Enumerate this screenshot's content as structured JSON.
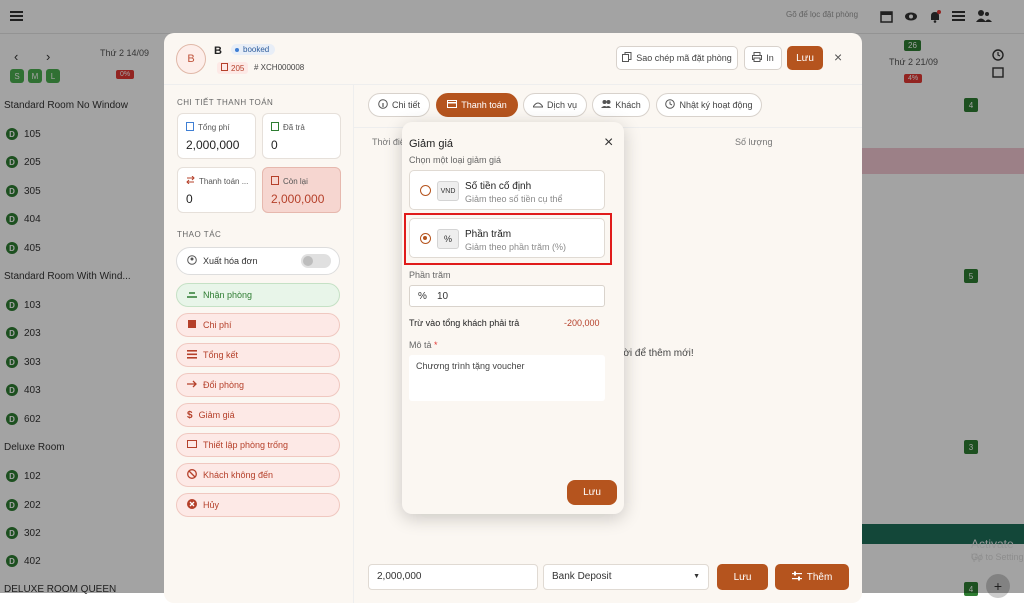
{
  "background": {
    "search_placeholder": "Gõ để lọc đặt phòng",
    "date_left": "Thứ 2 14/09",
    "date_right": "Thứ 2 21/09",
    "size_chips": [
      "S",
      "M",
      "L"
    ],
    "pct_left": "0%",
    "pct_right": "4%",
    "count_right": "26",
    "groups": [
      {
        "label": "Standard Room No Window",
        "rooms": [
          "105",
          "205",
          "305",
          "404",
          "405"
        ]
      },
      {
        "label": "Standard Room With Wind...",
        "rooms": [
          "103",
          "203",
          "303",
          "403",
          "602"
        ]
      },
      {
        "label": "Deluxe Room",
        "rooms": [
          "102",
          "202",
          "302",
          "402"
        ]
      },
      {
        "label": "DELUXE ROOM QUEEN",
        "rooms": []
      }
    ],
    "room_badge": "D",
    "right_counts": [
      "4",
      "5",
      "3",
      "4"
    ],
    "activate_title": "Activate W",
    "activate_sub": "Go to Setting"
  },
  "booking": {
    "avatar_letter": "B",
    "guest": "B",
    "status": "booked",
    "room": "205",
    "code": "# XCH000008",
    "copy_btn": "Sao chép mã đặt phòng",
    "print_btn": "In",
    "save_btn": "Lưu",
    "payment_title": "CHI TIẾT THANH TOÁN",
    "cards": {
      "total_label": "Tổng phí",
      "total_value": "2,000,000",
      "paid_label": "Đã trả",
      "paid_value": "0",
      "payment_label": "Thanh toán ...",
      "payment_value": "0",
      "remaining_label": "Còn lại",
      "remaining_value": "2,000,000"
    },
    "actions_title": "THAO TÁC",
    "actions": {
      "invoice": "Xuất hóa đơn",
      "checkin": "Nhận phòng",
      "cost": "Chi phí",
      "summary": "Tổng kết",
      "change_room": "Đổi phòng",
      "discount": "Giảm giá",
      "empty_room": "Thiết lập phòng trống",
      "noshow": "Khách không đến",
      "cancel": "Hủy"
    },
    "tabs": [
      "Chi tiết",
      "Thanh toán",
      "Dịch vụ",
      "Khách",
      "Nhật ký hoạt động"
    ],
    "table_col_time": "Thời điể",
    "table_col_qty": "Số lượng",
    "empty_msg": "rời để thêm mới!",
    "bottom_amount": "2,000,000",
    "bottom_method": "Bank Deposit",
    "bottom_save": "Lưu",
    "bottom_add": "Thêm"
  },
  "dialog": {
    "title": "Giảm giá",
    "subtitle": "Chọn một loại giảm giá",
    "option_fixed_icon": "VND",
    "option_fixed_title": "Số tiền cố định",
    "option_fixed_desc": "Giảm theo số tiền cụ thể",
    "option_pct_icon": "%",
    "option_pct_title": "Phần trăm",
    "option_pct_desc": "Giảm theo phần trăm (%)",
    "field_label": "Phần trăm",
    "field_prefix": "%",
    "field_value": "10",
    "deduct_label": "Trừ vào tổng khách phải trả",
    "deduct_value": "-200,000",
    "note_label": "Mô tả",
    "note_required": "*",
    "note_value": "Chương trình tặng voucher",
    "save_btn": "Lưu"
  },
  "colors": {
    "brand": "#b5541e",
    "highlight": "#e01b1b",
    "green": "#2e7d32"
  }
}
